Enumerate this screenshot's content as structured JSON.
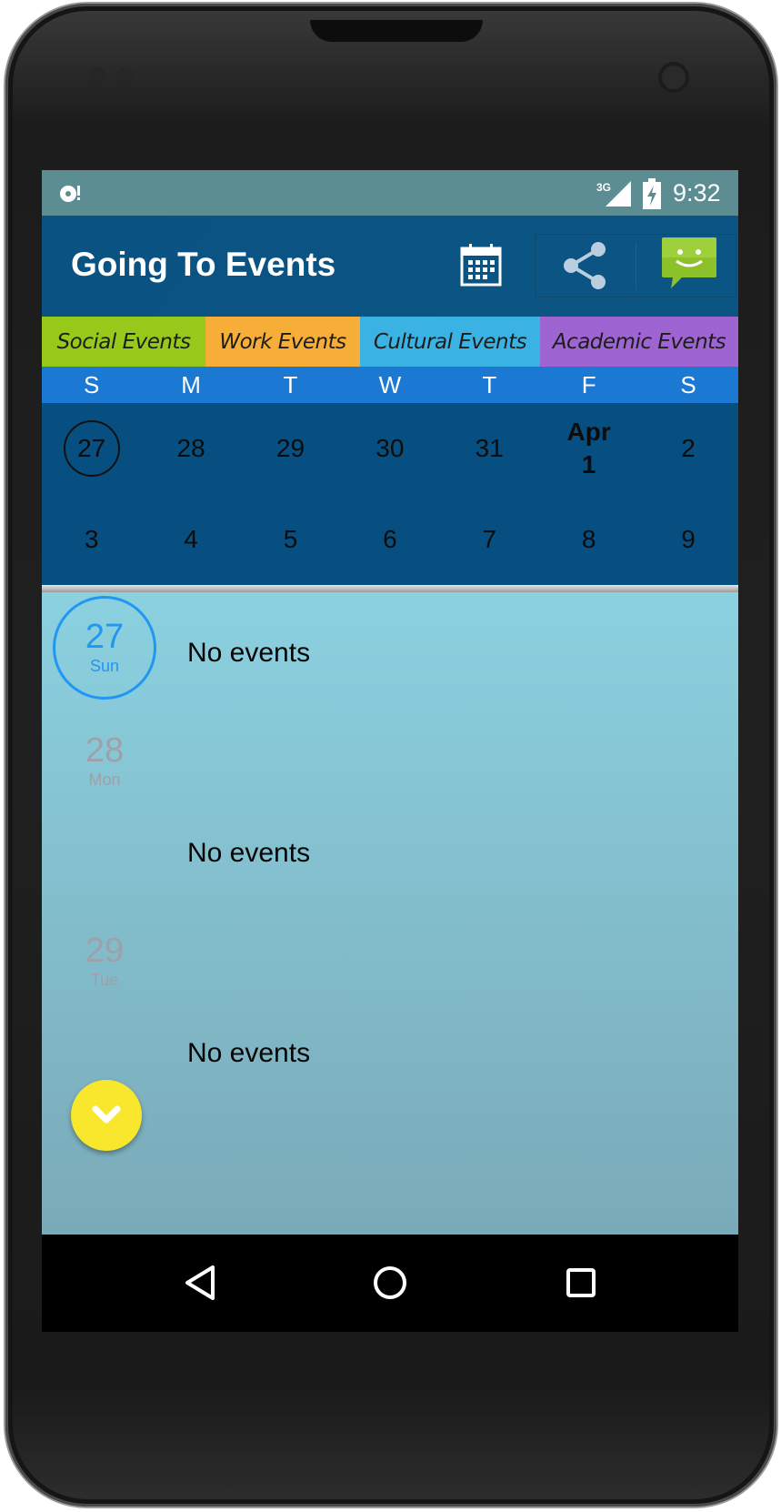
{
  "status_bar": {
    "time": "9:32",
    "network": "3G",
    "icons": [
      "notification-icon",
      "signal-icon",
      "battery-icon"
    ]
  },
  "app_bar": {
    "title": "Going To Events",
    "actions": [
      "calendar-icon",
      "share-icon",
      "sms-icon"
    ]
  },
  "categories": [
    {
      "label": "Social Events",
      "color": "#97c91b"
    },
    {
      "label": "Work Events",
      "color": "#f7ae38"
    },
    {
      "label": "Cultural Events",
      "color": "#3ab2e4"
    },
    {
      "label": "Academic Events",
      "color": "#9d64d2"
    }
  ],
  "weekdays": [
    "S",
    "M",
    "T",
    "W",
    "T",
    "F",
    "S"
  ],
  "month_grid": {
    "week1": [
      "27",
      "28",
      "29",
      "30",
      "31",
      "Apr",
      "1",
      "2"
    ],
    "week2": [
      "3",
      "4",
      "5",
      "6",
      "7",
      "8",
      "9"
    ],
    "today": "27",
    "month_start_label": "Apr"
  },
  "agenda": [
    {
      "day": "27",
      "dow": "Sun",
      "text": "No events",
      "selected": true
    },
    {
      "day": "28",
      "dow": "Mon",
      "text": "No events",
      "selected": false
    },
    {
      "day": "29",
      "dow": "Tue",
      "text": "No events",
      "selected": false
    }
  ],
  "colors": {
    "status_bar": "#5b8d93",
    "app_bar": "#0a5282",
    "weekday_bar": "#1b79d4",
    "month_grid": "#074f80",
    "selected_accent": "#2196f3",
    "fab": "#f8e72c"
  },
  "fab": {
    "icon": "chevron-down-icon"
  },
  "nav_bar": [
    "back-icon",
    "home-icon",
    "recents-icon"
  ]
}
